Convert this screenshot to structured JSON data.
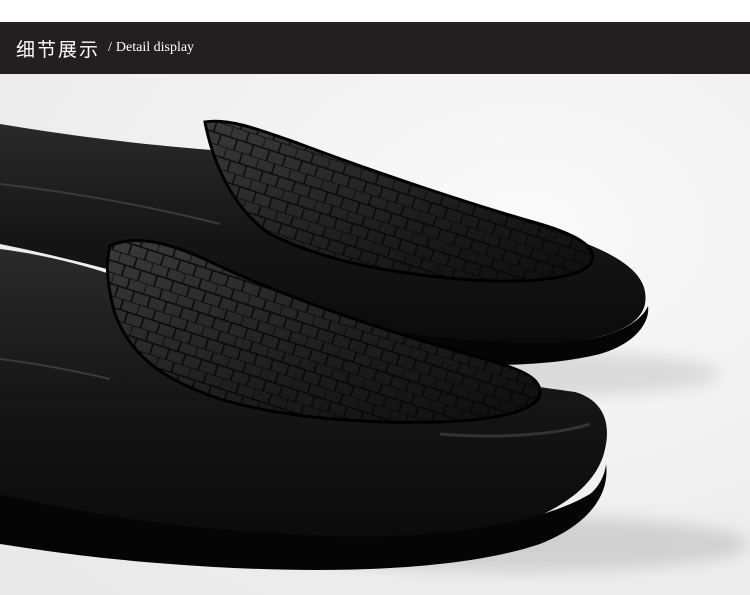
{
  "header": {
    "title_cn": "细节展示",
    "separator": "/",
    "title_en": "Detail display"
  },
  "photo": {
    "subject": "shoe-photo",
    "colors": {
      "background": "#f3f3f3",
      "leather": "#121212",
      "header_bar": "#231f20"
    }
  }
}
